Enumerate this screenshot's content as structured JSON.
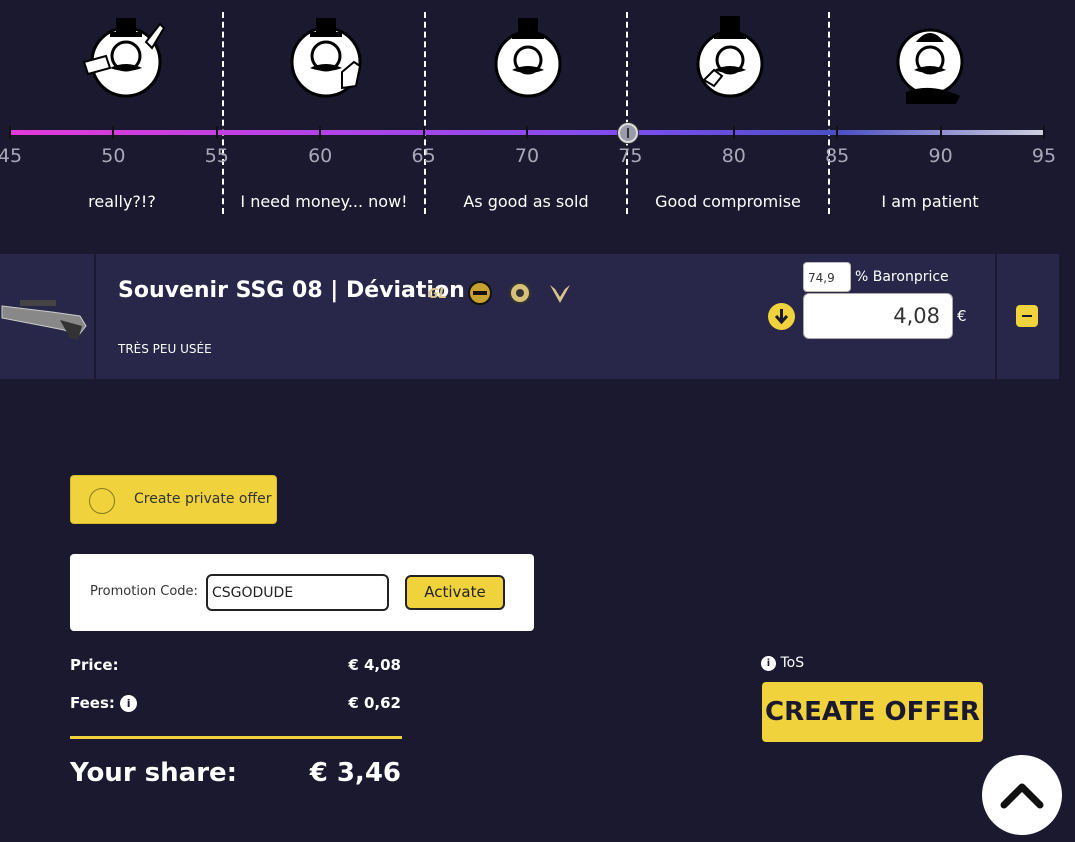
{
  "slider": {
    "ticks": [
      "45",
      "50",
      "55",
      "60",
      "65",
      "70",
      "75",
      "80",
      "85",
      "90",
      "95"
    ],
    "value": 74.9,
    "categories": [
      {
        "name": "really",
        "label": "really?!?"
      },
      {
        "name": "need-money",
        "label": "I need money... now!"
      },
      {
        "name": "good-as-sold",
        "label": "As good as sold"
      },
      {
        "name": "compromise",
        "label": "Good compromise"
      },
      {
        "name": "patient",
        "label": "I am patient"
      }
    ]
  },
  "item": {
    "name": "Souvenir SSG 08 | Déviation",
    "wear": "TRÈS PEU USÉE",
    "percent": "74,9",
    "percent_label": "% Baronprice",
    "price": "4,08",
    "currency": "€",
    "stickers": [
      "gamers2-sticker",
      "cologne-sticker",
      "dreamhack-sticker",
      "vitality-sticker"
    ]
  },
  "private_offer": {
    "label": "Create private offer"
  },
  "promo": {
    "label": "Promotion Code:",
    "value": "CSGODUDE",
    "button": "Activate"
  },
  "summary": {
    "price_label": "Price:",
    "price_value": "€ 4,08",
    "fees_label": "Fees:",
    "fees_value": "€ 0,62",
    "share_label": "Your share:",
    "share_value": "€ 3,46"
  },
  "tos": {
    "label": "ToS"
  },
  "create_offer": {
    "label": "CREATE OFFER"
  },
  "colors": {
    "accent": "#f0d23c",
    "background": "#1a1930",
    "row": "#28274a"
  }
}
